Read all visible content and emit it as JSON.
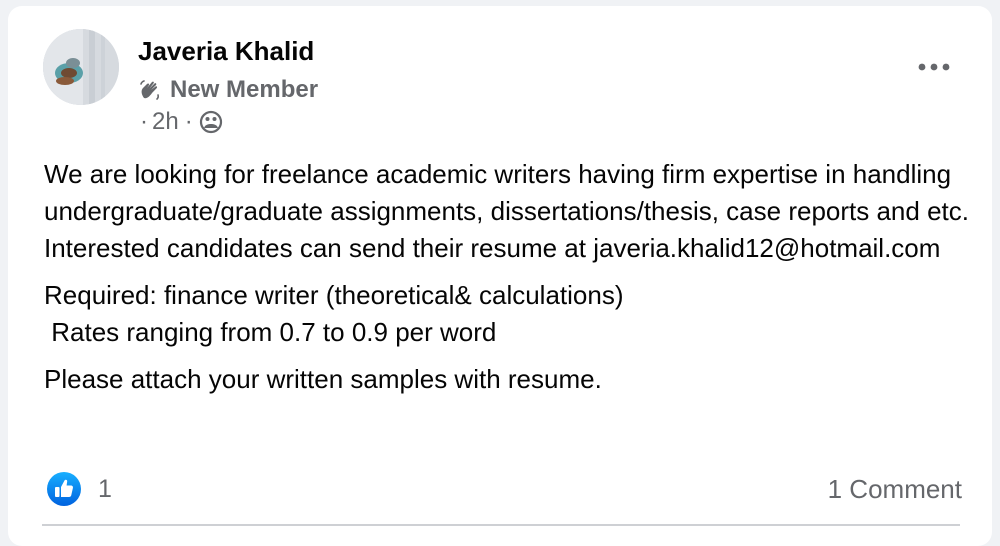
{
  "post": {
    "author": {
      "name": "Javeria Khalid",
      "badge": "New Member",
      "badge_icon": "waving-hand-icon",
      "avatar_icon": "avatar-photo"
    },
    "meta": {
      "time": "2h",
      "separator": "·",
      "audience_icon": "group-icon"
    },
    "more_icon": "more-options-icon",
    "paragraphs": [
      "We are looking for freelance academic writers having firm expertise in handling undergraduate/graduate assignments, dissertations/thesis, case reports and etc. Interested candidates can send their resume at javeria.khalid12@hotmail.com",
      "Required: finance writer (theoretical& calculations)\n Rates ranging from 0.7 to 0.9 per word",
      "Please attach your written samples with resume."
    ],
    "reactions": {
      "icon": "like-icon",
      "count": "1"
    },
    "comments": {
      "label": "1 Comment"
    }
  },
  "colors": {
    "text_primary": "#050505",
    "text_secondary": "#65676b",
    "like_blue": "#1877f2",
    "card_background": "#ffffff",
    "page_background": "#f0f2f5"
  }
}
